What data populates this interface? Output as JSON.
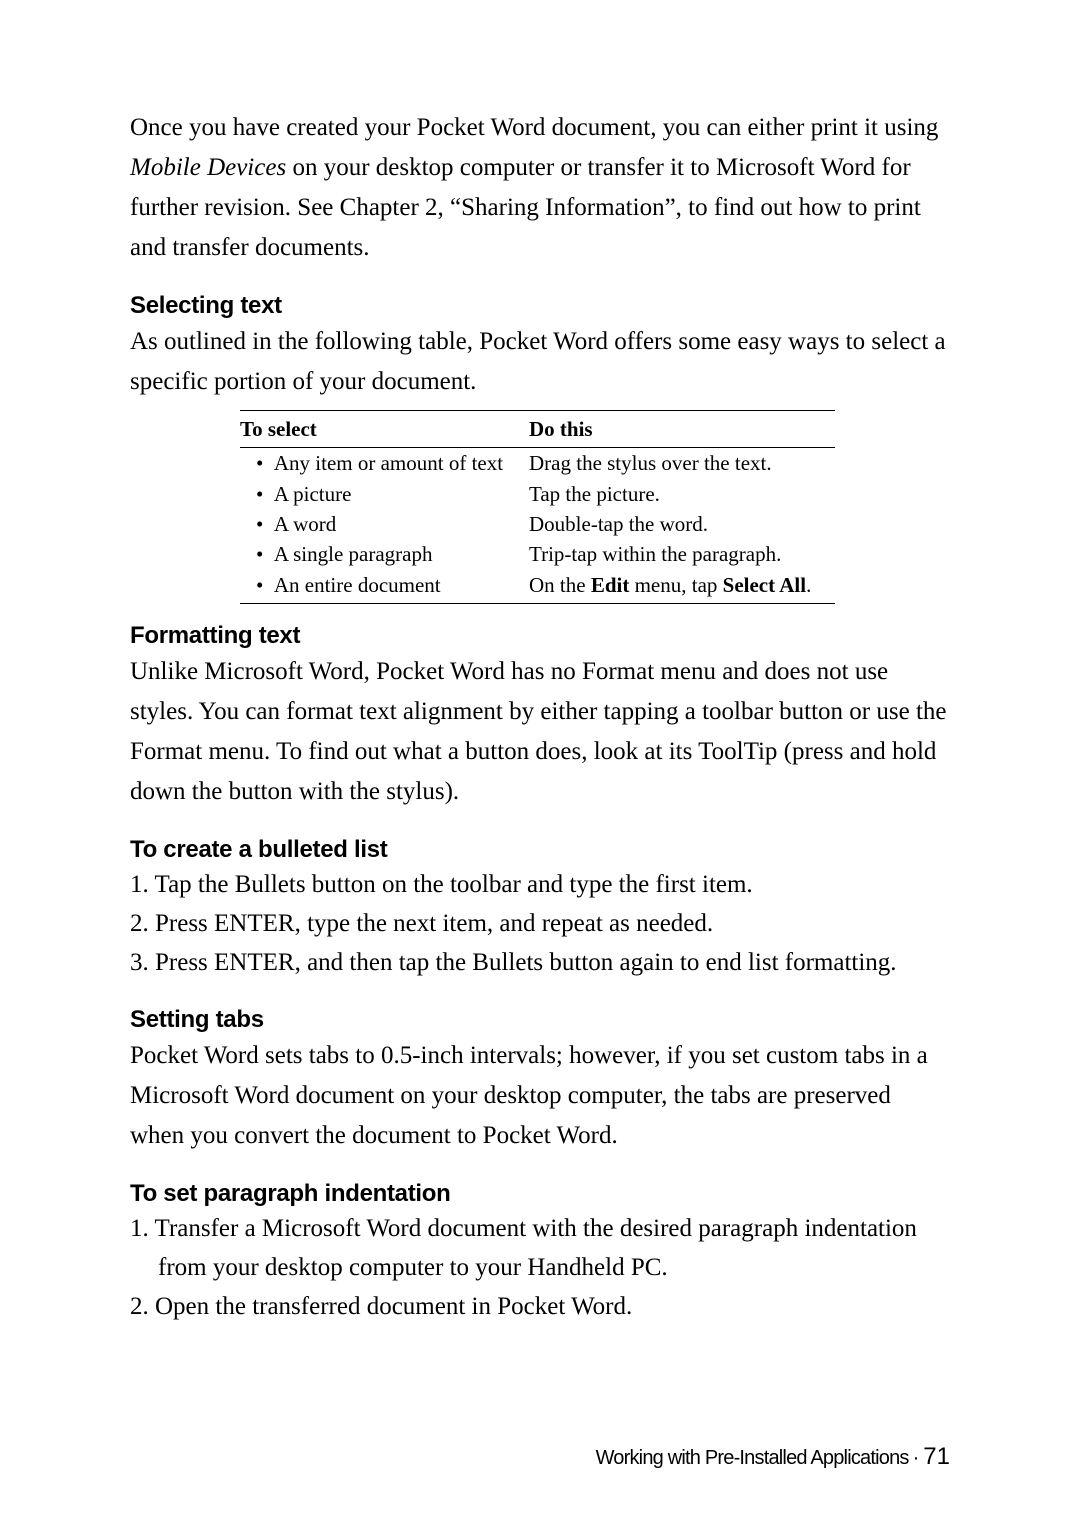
{
  "intro_pre": "Once you have created your Pocket Word document, you can either print it using ",
  "intro_italic": "Mobile Devices",
  "intro_post": " on your desktop computer or transfer it to Microsoft Word for further revision. See Chapter 2, “Sharing Information”, to find out how to print and transfer documents.",
  "sec1": {
    "heading": "Selecting text",
    "para": "As outlined in the following table, Pocket Word offers some easy ways to select a specific portion of your document."
  },
  "table": {
    "h1": "To select",
    "h2": "Do this",
    "rows": [
      {
        "c1": "Any item or amount of text",
        "c2": "Drag the stylus over the text."
      },
      {
        "c1": "A picture",
        "c2": "Tap the picture."
      },
      {
        "c1": "A word",
        "c2": "Double-tap the word."
      },
      {
        "c1": "A single paragraph",
        "c2": "Trip-tap within the paragraph."
      },
      {
        "c1": "An entire document",
        "c2_a": "On the ",
        "c2_b": "Edit",
        "c2_c": " menu, tap ",
        "c2_d": "Select All",
        "c2_e": "."
      }
    ]
  },
  "sec2": {
    "heading": "Formatting text",
    "para": "Unlike Microsoft Word, Pocket Word has no Format menu and does not use styles. You can format text alignment by either tapping a toolbar button or use the Format menu. To find out what a button does, look at its ToolTip (press and hold down the button with the stylus)."
  },
  "sec3": {
    "heading": "To create a bulleted list",
    "items": [
      "1. Tap the Bullets button on the toolbar and type the first item.",
      "2. Press ENTER, type the next item, and repeat as needed.",
      "3. Press ENTER, and then tap the Bullets button again to end list formatting."
    ]
  },
  "sec4": {
    "heading": "Setting tabs",
    "para": "Pocket Word sets tabs to 0.5-inch intervals; however, if you set custom tabs in a Microsoft Word document on your desktop computer, the tabs are preserved when you convert the document to Pocket Word."
  },
  "sec5": {
    "heading": "To set paragraph indentation",
    "items": [
      "1. Transfer a Microsoft Word document with the desired paragraph indentation from your desktop computer to your Handheld PC.",
      "2. Open the transferred document in Pocket Word."
    ]
  },
  "footer": {
    "label": "Working with Pre-Installed Applications",
    "page": "71"
  }
}
